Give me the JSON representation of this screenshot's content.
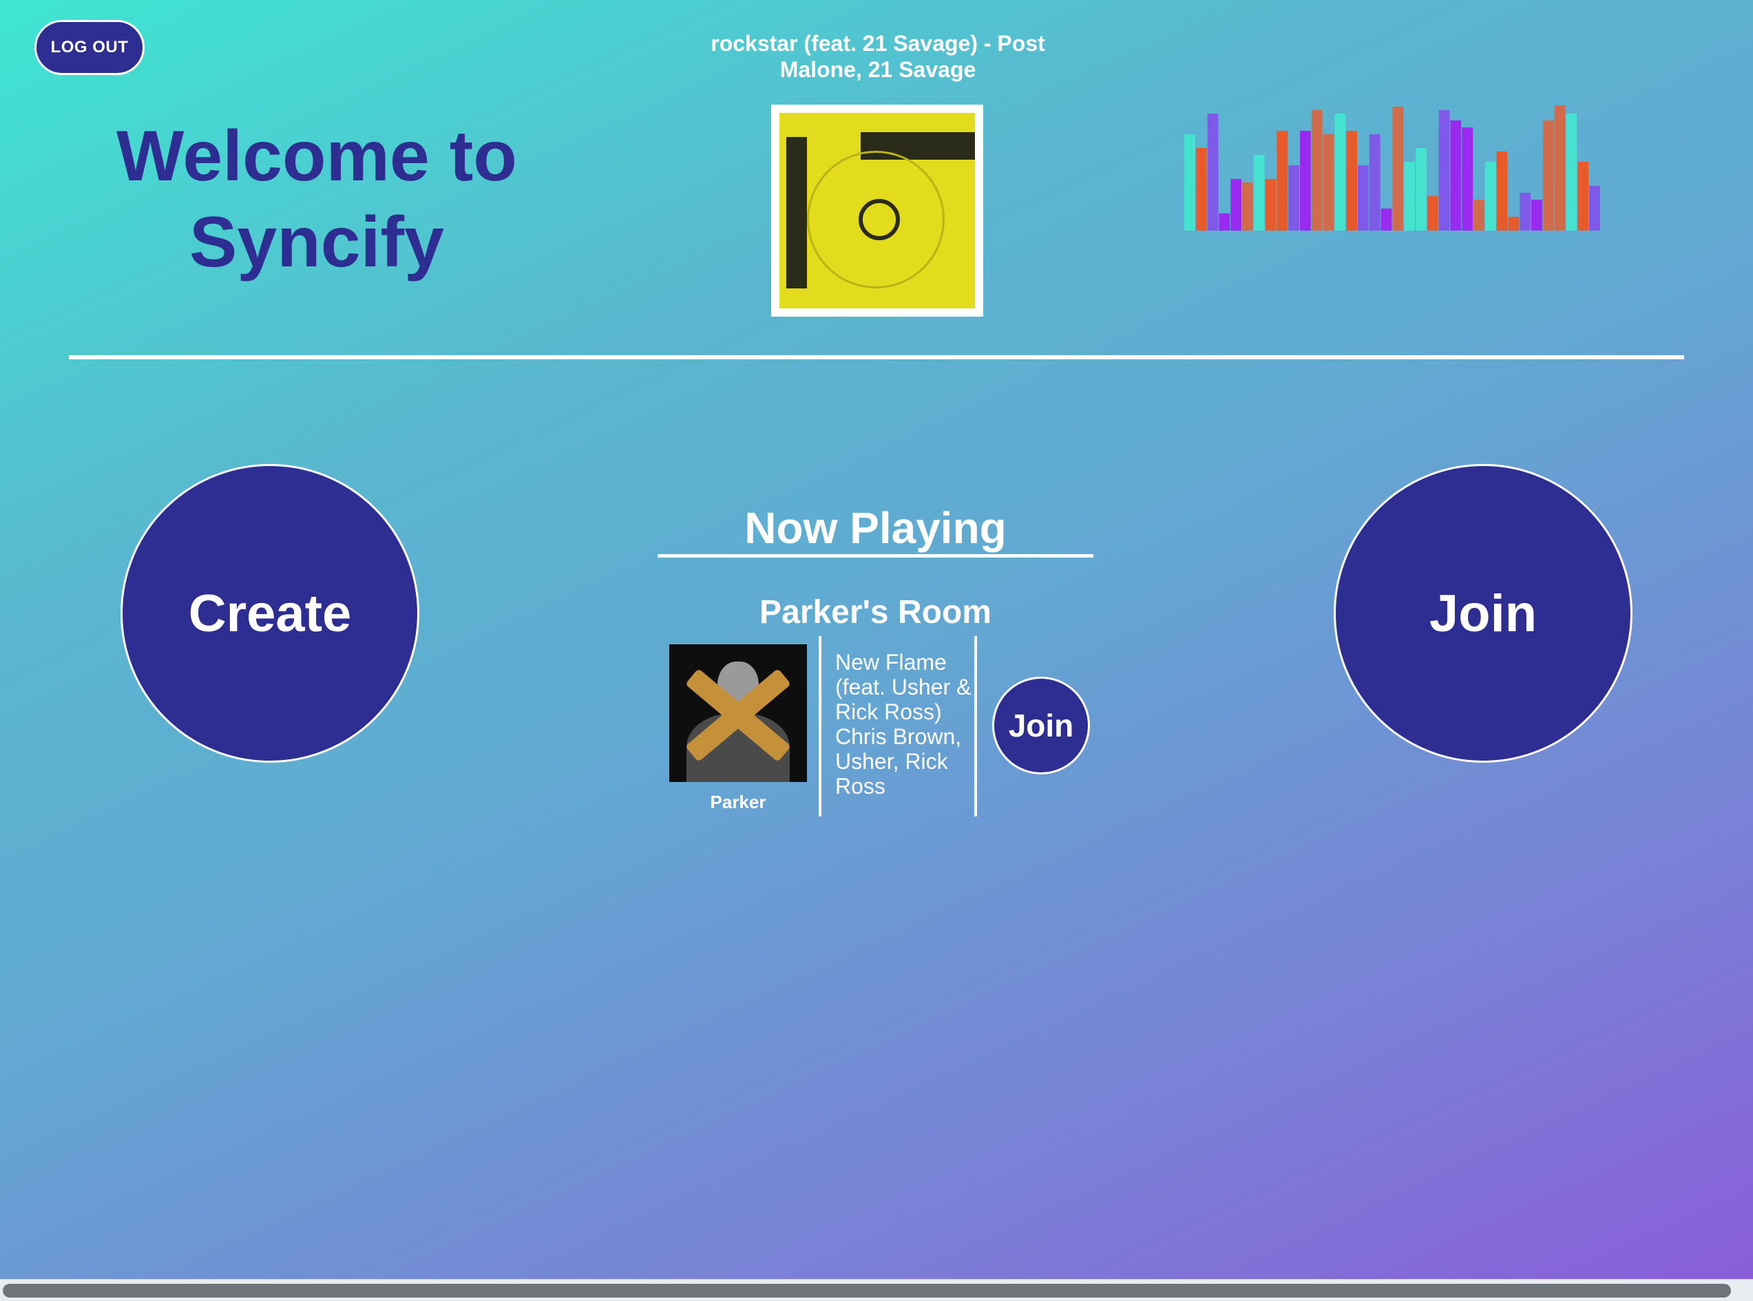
{
  "header": {
    "logout_label": "LOG OUT",
    "welcome_line1": "Welcome to",
    "welcome_line2": "Syncify",
    "current_track_line1": "rockstar (feat. 21 Savage) - Post",
    "current_track_line2": "Malone, 21 Savage",
    "album_cover_icon": "beerbongs-bentleys-album-cover",
    "visualizer_icon": "audio-visualizer-icon"
  },
  "actions": {
    "create_label": "Create",
    "join_label": "Join"
  },
  "now_playing": {
    "title": "Now Playing",
    "rooms": [
      {
        "room_name": "Parker's Room",
        "host": "Parker",
        "album_icon": "x-album-cover",
        "song_info": "New Flame (feat. Usher & Rick Ross) Chris Brown, Usher, Rick Ross",
        "join_label": "Join"
      }
    ]
  },
  "colors": {
    "primary": "#2e2e92",
    "text_light": "#ffffff",
    "gradient_start": "#3ee6d2",
    "gradient_end": "#8a5cd8"
  }
}
